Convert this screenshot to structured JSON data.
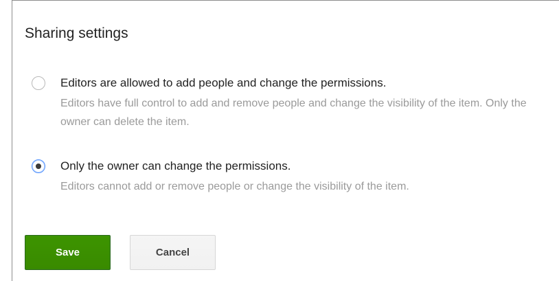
{
  "dialog": {
    "title": "Sharing settings"
  },
  "options": [
    {
      "label": "Editors are allowed to add people and change the permissions.",
      "description": "Editors have full control to add and remove people and change the visibility of the item. Only the owner can delete the item.",
      "selected": false
    },
    {
      "label": "Only the owner can change the permissions.",
      "description": "Editors cannot add or remove people or change the visibility of the item.",
      "selected": true
    }
  ],
  "buttons": {
    "save_label": "Save",
    "cancel_label": "Cancel"
  },
  "colors": {
    "save_button": "#3d9400",
    "radio_focus": "#4d90fe",
    "description_text": "#9a9a9a"
  }
}
